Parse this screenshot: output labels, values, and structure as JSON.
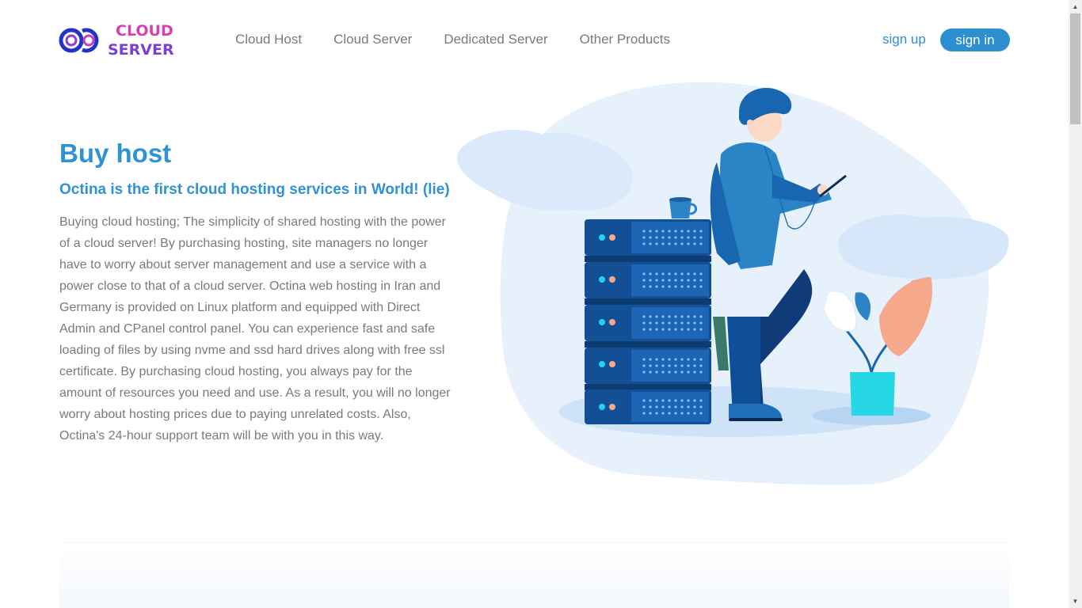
{
  "brand": {
    "line1": "CLOUD",
    "line2": "SERVER",
    "colors": {
      "pink": "#d63fb3",
      "purple": "#7b3fd6",
      "ring_blue": "#2233c9"
    }
  },
  "nav": {
    "items": [
      {
        "label": "Cloud Host"
      },
      {
        "label": "Cloud Server"
      },
      {
        "label": "Dedicated Server"
      },
      {
        "label": "Other Products"
      }
    ]
  },
  "auth": {
    "signup_label": "sign up",
    "signin_label": "sign in"
  },
  "hero": {
    "title": "Buy host",
    "subtitle": "Octina is the first cloud hosting services in World! (lie)",
    "body": "Buying cloud hosting; The simplicity of shared hosting with the power of a cloud server! By purchasing hosting, site managers no longer have to worry about server management and use a service with a power close to that of a cloud server. Octina web hosting in Iran and Germany is provided on Linux platform and equipped with Direct Admin and CPanel control panel. You can experience fast and safe loading of files by using nvme and ssd hard drives along with free ssl certificate. By purchasing cloud hosting, you always pay for the amount of resources you need and use. As a result, you will no longer worry about hosting prices due to paying unrelated costs. Also, Octina's 24-hour support team will be with you in this way."
  },
  "theme": {
    "accent": "#2f93d3",
    "text_muted": "#7a7a7a",
    "button_bg": "#2c8fd0"
  },
  "illustration": {
    "icons": [
      "server-rack-icon",
      "person-with-phone-icon",
      "coffee-cup-icon",
      "potted-plant-icon"
    ]
  }
}
